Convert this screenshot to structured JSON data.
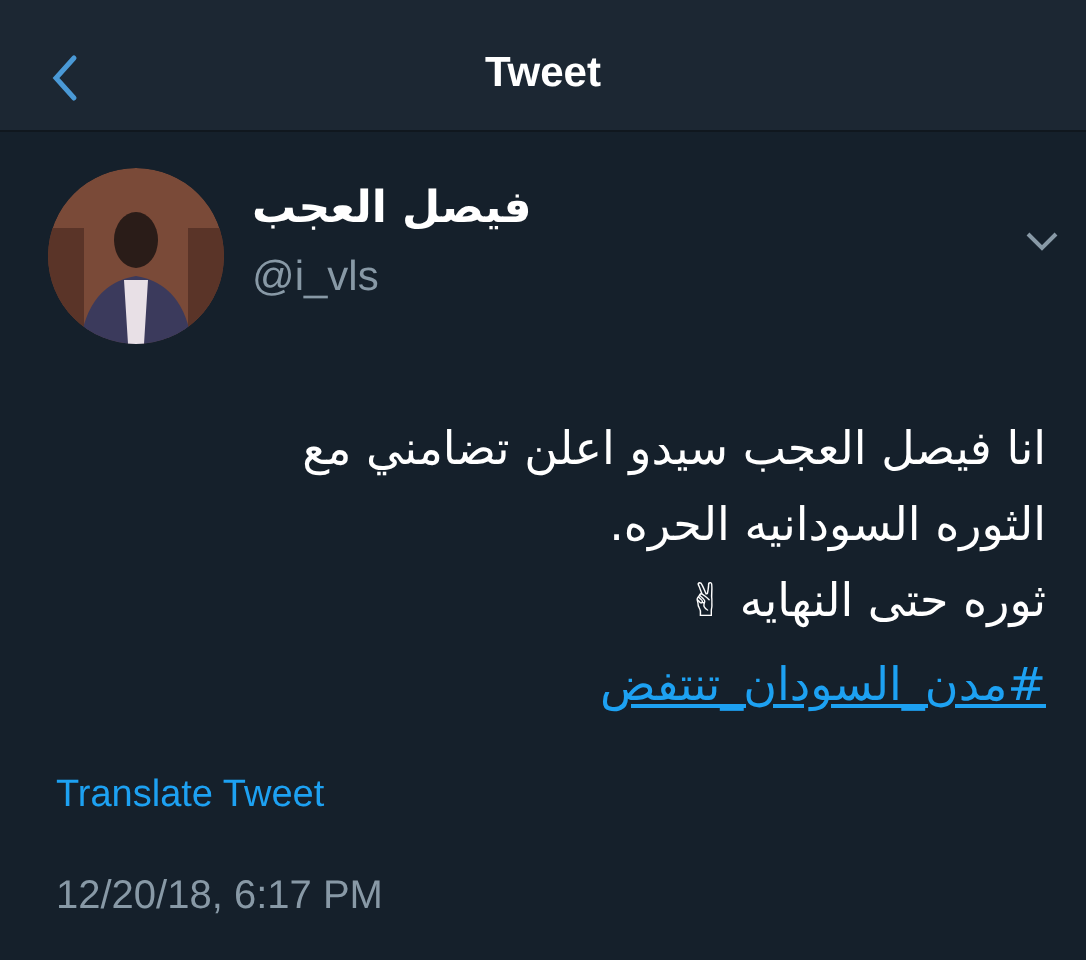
{
  "header": {
    "title": "Tweet"
  },
  "tweet": {
    "author_name": "فيصل العجب",
    "handle": "@i_vls",
    "lines": [
      "انا فيصل العجب سيدو اعلن تضامني مع",
      "الثوره السودانيه الحره.",
      "ثوره حتى النهايه ✌"
    ],
    "hashtag": "#مدن_السودان_تنتفض",
    "translate_link": "Translate Tweet",
    "timestamp": "12/20/18, 6:17 PM"
  }
}
